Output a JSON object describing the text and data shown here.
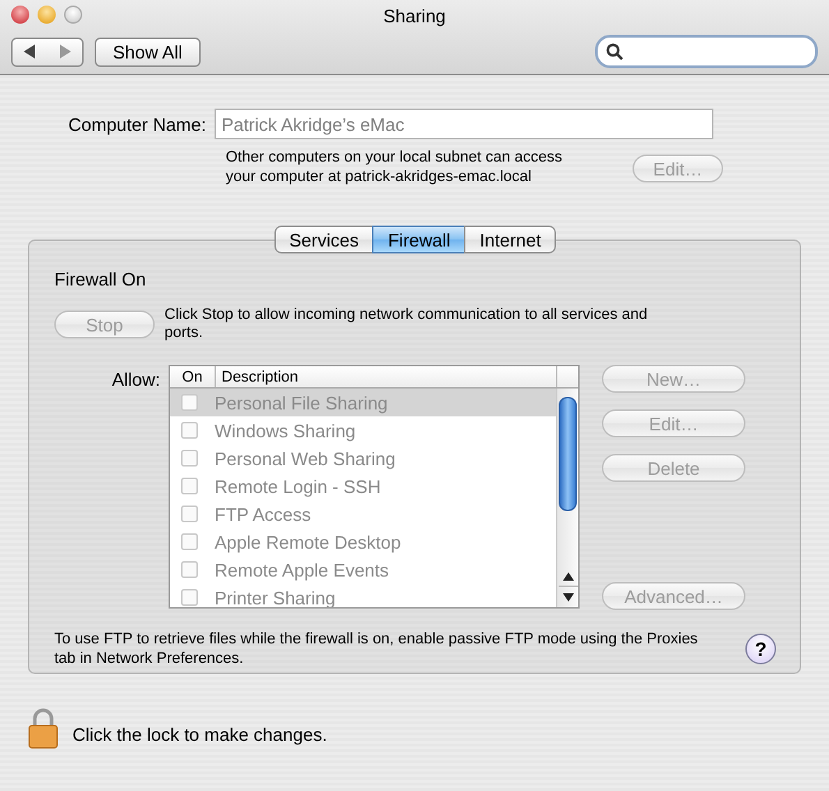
{
  "window": {
    "title": "Sharing"
  },
  "toolbar": {
    "show_all": "Show All"
  },
  "computer_name": {
    "label": "Computer Name:",
    "value": "Patrick Akridge’s eMac",
    "note": "Other computers on your local subnet can access\nyour computer at patrick-akridges-emac.local",
    "edit_button": {
      "label": "Edit…",
      "disabled": true
    }
  },
  "tabs": [
    {
      "label": "Services",
      "selected": false
    },
    {
      "label": "Firewall",
      "selected": true
    },
    {
      "label": "Internet",
      "selected": false
    }
  ],
  "firewall": {
    "status": "Firewall On",
    "stop_button": {
      "label": "Stop",
      "disabled": true
    },
    "stop_note": "Click Stop to allow incoming network communication to all services and ports.",
    "allow_label": "Allow:",
    "disabled": true,
    "columns": [
      "On",
      "Description"
    ],
    "rows": [
      {
        "description": "Personal File Sharing",
        "checked": false,
        "selected": true
      },
      {
        "description": "Windows Sharing",
        "checked": false,
        "selected": false
      },
      {
        "description": "Personal Web Sharing",
        "checked": false,
        "selected": false
      },
      {
        "description": "Remote Login - SSH",
        "checked": false,
        "selected": false
      },
      {
        "description": "FTP Access",
        "checked": false,
        "selected": false
      },
      {
        "description": "Apple Remote Desktop",
        "checked": false,
        "selected": false
      },
      {
        "description": "Remote Apple Events",
        "checked": false,
        "selected": false
      },
      {
        "description": "Printer Sharing",
        "checked": false,
        "selected": false
      }
    ],
    "buttons": [
      {
        "label": "New…",
        "disabled": true
      },
      {
        "label": "Edit…",
        "disabled": true
      },
      {
        "label": "Delete",
        "disabled": true
      },
      {
        "label": "Advanced…",
        "disabled": true
      }
    ],
    "help": "?",
    "footnote": "To use FTP to retrieve files while the firewall is on, enable passive FTP mode using the Proxies tab in Network Preferences."
  },
  "lock": {
    "locked": true,
    "text": "Click the lock to make changes."
  }
}
